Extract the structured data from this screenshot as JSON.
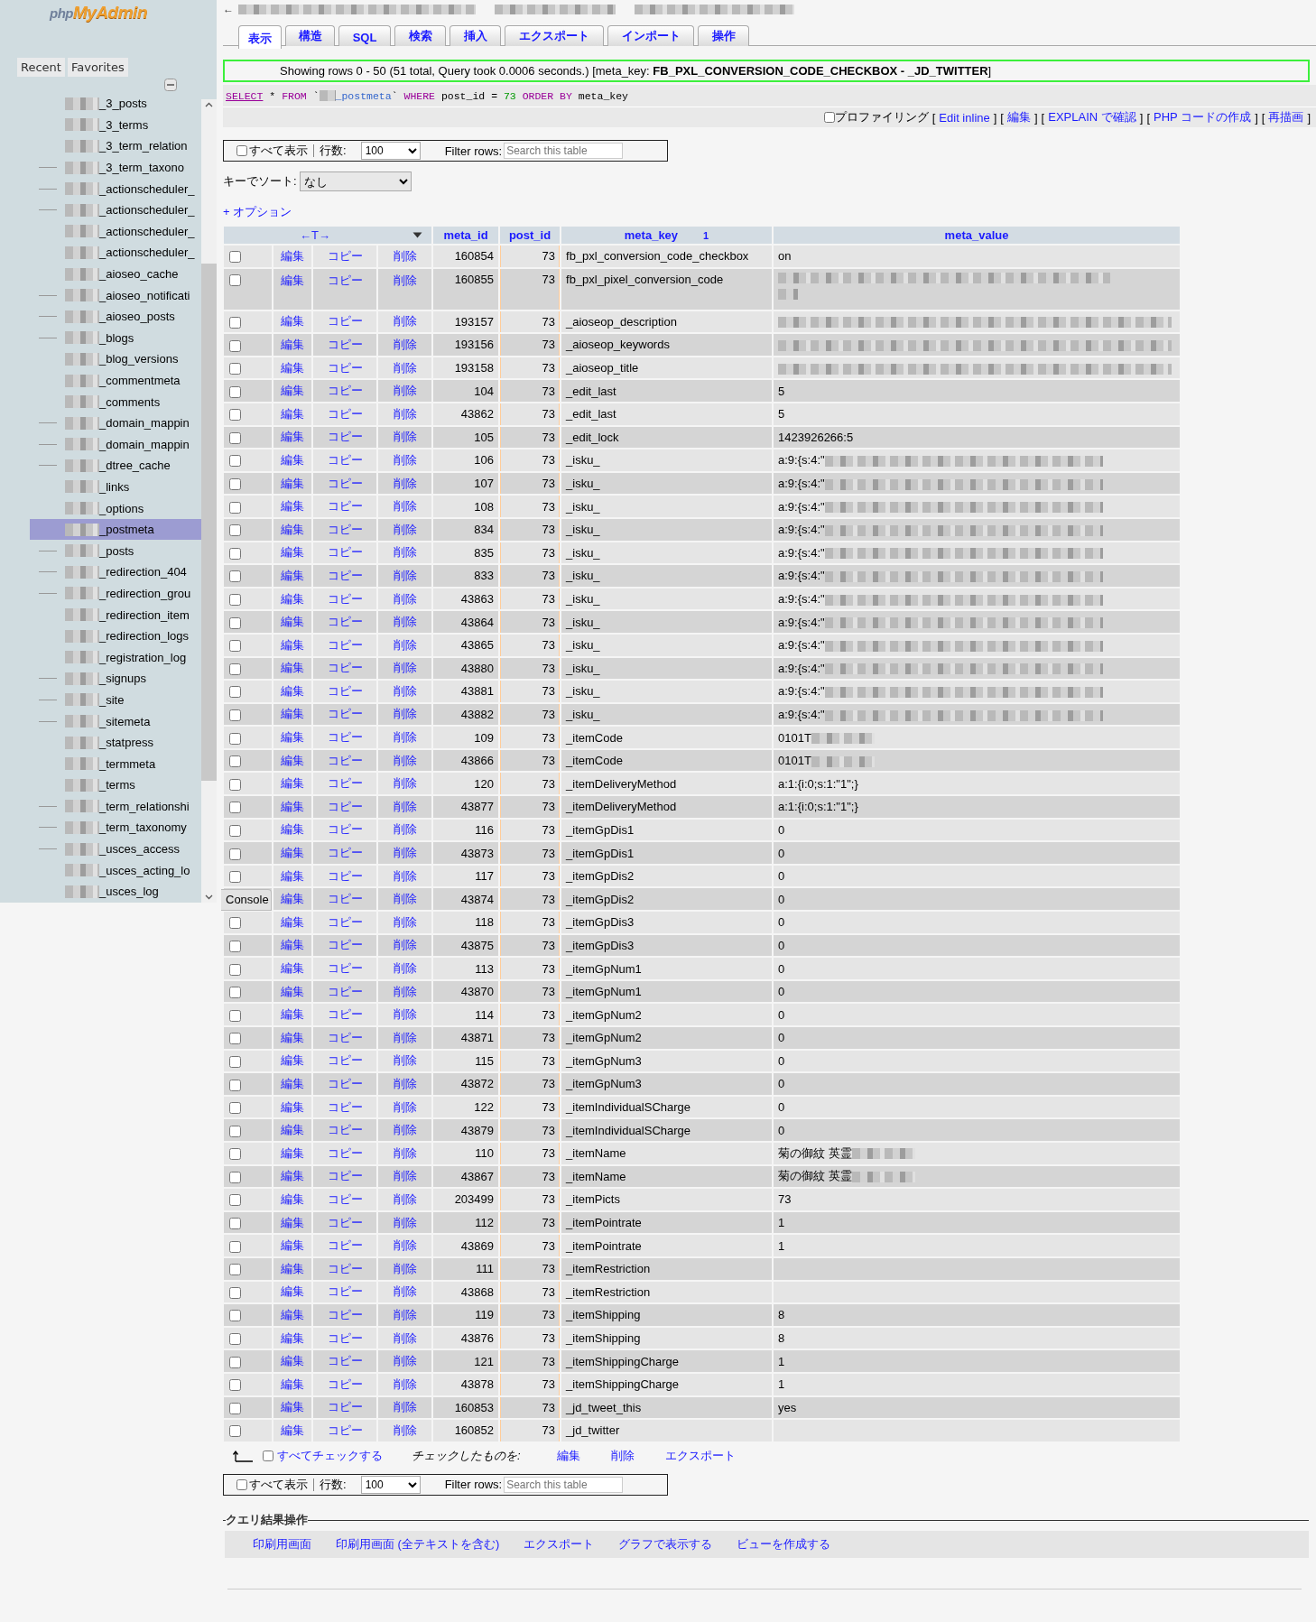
{
  "sidebar": {
    "logo": {
      "prefix": "php",
      "name": "MyAdmin"
    },
    "buttons": [
      "Recent",
      "Favorites"
    ],
    "tables": [
      {
        "name": "_3_posts",
        "connector": false,
        "selected": false
      },
      {
        "name": "_3_terms",
        "connector": false,
        "selected": false
      },
      {
        "name": "_3_term_relation",
        "connector": false,
        "selected": false
      },
      {
        "name": "_3_term_taxono",
        "connector": true,
        "selected": false
      },
      {
        "name": "_actionscheduler_",
        "connector": true,
        "selected": false
      },
      {
        "name": "_actionscheduler_",
        "connector": true,
        "selected": false
      },
      {
        "name": "_actionscheduler_",
        "connector": false,
        "selected": false
      },
      {
        "name": "_actionscheduler_",
        "connector": false,
        "selected": false
      },
      {
        "name": "_aioseo_cache",
        "connector": false,
        "selected": false
      },
      {
        "name": "_aioseo_notificati",
        "connector": true,
        "selected": false
      },
      {
        "name": "_aioseo_posts",
        "connector": true,
        "selected": false
      },
      {
        "name": "_blogs",
        "connector": true,
        "selected": false
      },
      {
        "name": "_blog_versions",
        "connector": false,
        "selected": false
      },
      {
        "name": "_commentmeta",
        "connector": false,
        "selected": false
      },
      {
        "name": "_comments",
        "connector": false,
        "selected": false
      },
      {
        "name": "_domain_mappin",
        "connector": true,
        "selected": false
      },
      {
        "name": "_domain_mappin",
        "connector": true,
        "selected": false
      },
      {
        "name": "_dtree_cache",
        "connector": true,
        "selected": false
      },
      {
        "name": "_links",
        "connector": false,
        "selected": false
      },
      {
        "name": "_options",
        "connector": false,
        "selected": false
      },
      {
        "name": "_postmeta",
        "connector": false,
        "selected": true
      },
      {
        "name": "_posts",
        "connector": true,
        "selected": false
      },
      {
        "name": "_redirection_404",
        "connector": true,
        "selected": false
      },
      {
        "name": "_redirection_grou",
        "connector": true,
        "selected": false
      },
      {
        "name": "_redirection_item",
        "connector": false,
        "selected": false
      },
      {
        "name": "_redirection_logs",
        "connector": false,
        "selected": false
      },
      {
        "name": "_registration_log",
        "connector": false,
        "selected": false
      },
      {
        "name": "_signups",
        "connector": true,
        "selected": false
      },
      {
        "name": "_site",
        "connector": true,
        "selected": false
      },
      {
        "name": "_sitemeta",
        "connector": true,
        "selected": false
      },
      {
        "name": "_statpress",
        "connector": false,
        "selected": false
      },
      {
        "name": "_termmeta",
        "connector": false,
        "selected": false
      },
      {
        "name": "_terms",
        "connector": false,
        "selected": false
      },
      {
        "name": "_term_relationshi",
        "connector": true,
        "selected": false
      },
      {
        "name": "_term_taxonomy",
        "connector": true,
        "selected": false
      },
      {
        "name": "_usces_access",
        "connector": true,
        "selected": false
      },
      {
        "name": "_usces_acting_lo",
        "connector": false,
        "selected": false
      },
      {
        "name": "_usces_log",
        "connector": false,
        "selected": false
      }
    ]
  },
  "console": "Console",
  "breadcrumb": {
    "back": "←"
  },
  "tabs": [
    {
      "label": "表示",
      "selected": true
    },
    {
      "label": "構造",
      "selected": false
    },
    {
      "label": "SQL",
      "selected": false
    },
    {
      "label": "検索",
      "selected": false
    },
    {
      "label": "挿入",
      "selected": false
    },
    {
      "label": "エクスポート",
      "selected": false
    },
    {
      "label": "インポート",
      "selected": false
    },
    {
      "label": "操作",
      "selected": false
    }
  ],
  "message": "Showing rows 0 - 50 (51 total, Query took 0.0006 seconds.) [meta_key: **FB_PXL_CONVERSION_CODE_CHECKBOX - _JD_TWITTER**]",
  "sql": [
    {
      "kind": "keyword",
      "text": "SELECT"
    },
    {
      "kind": "plain",
      "text": " * "
    },
    {
      "kind": "keyword",
      "text": "FROM"
    },
    {
      "kind": "plain",
      "text": " `"
    },
    {
      "kind": "redacted_name",
      "text": "_postmeta"
    },
    {
      "kind": "plain",
      "text": "` "
    },
    {
      "kind": "keyword",
      "text": "WHERE"
    },
    {
      "kind": "plain",
      "text": " post_id = "
    },
    {
      "kind": "number",
      "text": "73"
    },
    {
      "kind": "keyword",
      "text": " ORDER BY"
    },
    {
      "kind": "plain",
      "text": " meta_key"
    }
  ],
  "profiling": {
    "label": "プロファイリング",
    "checked": false,
    "links": [
      {
        "before": "[",
        "label": "Edit inline",
        "after": "]"
      },
      {
        "before": "[",
        "label": "編集",
        "after": "]"
      },
      {
        "before": "[",
        "label": "EXPLAIN で確認",
        "after": "]"
      },
      {
        "before": "[",
        "label": "PHP コードの作成",
        "after": "]"
      },
      {
        "before": "[",
        "label": "再描画",
        "after": "]"
      }
    ]
  },
  "nav_top": {
    "show_all": "すべて表示",
    "show_all_checked": false,
    "rows_label": "行数:",
    "rows_value": "100",
    "filter_label": "Filter rows:",
    "filter_placeholder": "Search this table"
  },
  "sort": {
    "label": "キーでソート:",
    "value": "なし"
  },
  "options": "+ オプション",
  "table": {
    "toggle": "←T→",
    "columns": [
      {
        "label": "meta_id"
      },
      {
        "label": "post_id"
      },
      {
        "label": "meta_key",
        "sort_index": "1"
      },
      {
        "label": "meta_value"
      }
    ],
    "rows": [
      {
        "kind": "plain",
        "checked": false,
        "edit": "編集",
        "copy": "コピー",
        "delete": "削除",
        "meta_id": "160854",
        "post_id": "73",
        "meta_key": "fb_pxl_conversion_code_checkbox",
        "meta_value": "on"
      },
      {
        "kind": "twoline",
        "checked": false,
        "edit": "編集",
        "copy": "コピー",
        "delete": "削除",
        "meta_id": "160855",
        "post_id": "73",
        "meta_key": "fb_pxl_pixel_conversion_code"
      },
      {
        "kind": "redacted",
        "checked": false,
        "edit": "編集",
        "copy": "コピー",
        "delete": "削除",
        "meta_id": "193157",
        "post_id": "73",
        "meta_key": "_aioseop_description"
      },
      {
        "kind": "redacted",
        "checked": false,
        "edit": "編集",
        "copy": "コピー",
        "delete": "削除",
        "meta_id": "193156",
        "post_id": "73",
        "meta_key": "_aioseop_keywords"
      },
      {
        "kind": "redacted",
        "checked": false,
        "edit": "編集",
        "copy": "コピー",
        "delete": "削除",
        "meta_id": "193158",
        "post_id": "73",
        "meta_key": "_aioseop_title"
      },
      {
        "kind": "plain",
        "checked": false,
        "edit": "編集",
        "copy": "コピー",
        "delete": "削除",
        "meta_id": "104",
        "post_id": "73",
        "meta_key": "_edit_last",
        "meta_value": "5"
      },
      {
        "kind": "plain",
        "checked": false,
        "edit": "編集",
        "copy": "コピー",
        "delete": "削除",
        "meta_id": "43862",
        "post_id": "73",
        "meta_key": "_edit_last",
        "meta_value": "5"
      },
      {
        "kind": "plain",
        "checked": false,
        "edit": "編集",
        "copy": "コピー",
        "delete": "削除",
        "meta_id": "105",
        "post_id": "73",
        "meta_key": "_edit_lock",
        "meta_value": "1423926266:5"
      },
      {
        "kind": "longtail",
        "checked": false,
        "edit": "編集",
        "copy": "コピー",
        "delete": "削除",
        "meta_id": "106",
        "post_id": "73",
        "meta_key": "_isku_",
        "meta_value": "a:9:{s:4:\""
      },
      {
        "kind": "longtail",
        "checked": false,
        "edit": "編集",
        "copy": "コピー",
        "delete": "削除",
        "meta_id": "107",
        "post_id": "73",
        "meta_key": "_isku_",
        "meta_value": "a:9:{s:4:\""
      },
      {
        "kind": "longtail",
        "checked": false,
        "edit": "編集",
        "copy": "コピー",
        "delete": "削除",
        "meta_id": "108",
        "post_id": "73",
        "meta_key": "_isku_",
        "meta_value": "a:9:{s:4:\""
      },
      {
        "kind": "longtail",
        "checked": false,
        "edit": "編集",
        "copy": "コピー",
        "delete": "削除",
        "meta_id": "834",
        "post_id": "73",
        "meta_key": "_isku_",
        "meta_value": "a:9:{s:4:\""
      },
      {
        "kind": "longtail",
        "checked": false,
        "edit": "編集",
        "copy": "コピー",
        "delete": "削除",
        "meta_id": "835",
        "post_id": "73",
        "meta_key": "_isku_",
        "meta_value": "a:9:{s:4:\""
      },
      {
        "kind": "longtail",
        "checked": false,
        "edit": "編集",
        "copy": "コピー",
        "delete": "削除",
        "meta_id": "833",
        "post_id": "73",
        "meta_key": "_isku_",
        "meta_value": "a:9:{s:4:\""
      },
      {
        "kind": "longtail",
        "checked": false,
        "edit": "編集",
        "copy": "コピー",
        "delete": "削除",
        "meta_id": "43863",
        "post_id": "73",
        "meta_key": "_isku_",
        "meta_value": "a:9:{s:4:\""
      },
      {
        "kind": "longtail",
        "checked": false,
        "edit": "編集",
        "copy": "コピー",
        "delete": "削除",
        "meta_id": "43864",
        "post_id": "73",
        "meta_key": "_isku_",
        "meta_value": "a:9:{s:4:\""
      },
      {
        "kind": "longtail",
        "checked": false,
        "edit": "編集",
        "copy": "コピー",
        "delete": "削除",
        "meta_id": "43865",
        "post_id": "73",
        "meta_key": "_isku_",
        "meta_value": "a:9:{s:4:\""
      },
      {
        "kind": "longtail",
        "checked": false,
        "edit": "編集",
        "copy": "コピー",
        "delete": "削除",
        "meta_id": "43880",
        "post_id": "73",
        "meta_key": "_isku_",
        "meta_value": "a:9:{s:4:\""
      },
      {
        "kind": "longtail",
        "checked": false,
        "edit": "編集",
        "copy": "コピー",
        "delete": "削除",
        "meta_id": "43881",
        "post_id": "73",
        "meta_key": "_isku_",
        "meta_value": "a:9:{s:4:\""
      },
      {
        "kind": "longtail",
        "checked": false,
        "edit": "編集",
        "copy": "コピー",
        "delete": "削除",
        "meta_id": "43882",
        "post_id": "73",
        "meta_key": "_isku_",
        "meta_value": "a:9:{s:4:\""
      },
      {
        "kind": "shorttail",
        "checked": false,
        "edit": "編集",
        "copy": "コピー",
        "delete": "削除",
        "meta_id": "109",
        "post_id": "73",
        "meta_key": "_itemCode",
        "meta_value": "0101T"
      },
      {
        "kind": "shorttail",
        "checked": false,
        "edit": "編集",
        "copy": "コピー",
        "delete": "削除",
        "meta_id": "43866",
        "post_id": "73",
        "meta_key": "_itemCode",
        "meta_value": "0101T"
      },
      {
        "kind": "plain",
        "checked": false,
        "edit": "編集",
        "copy": "コピー",
        "delete": "削除",
        "meta_id": "120",
        "post_id": "73",
        "meta_key": "_itemDeliveryMethod",
        "meta_value": "a:1:{i:0;s:1:\"1\";}"
      },
      {
        "kind": "plain",
        "checked": false,
        "edit": "編集",
        "copy": "コピー",
        "delete": "削除",
        "meta_id": "43877",
        "post_id": "73",
        "meta_key": "_itemDeliveryMethod",
        "meta_value": "a:1:{i:0;s:1:\"1\";}"
      },
      {
        "kind": "plain",
        "checked": false,
        "edit": "編集",
        "copy": "コピー",
        "delete": "削除",
        "meta_id": "116",
        "post_id": "73",
        "meta_key": "_itemGpDis1",
        "meta_value": "0"
      },
      {
        "kind": "plain",
        "checked": false,
        "edit": "編集",
        "copy": "コピー",
        "delete": "削除",
        "meta_id": "43873",
        "post_id": "73",
        "meta_key": "_itemGpDis1",
        "meta_value": "0"
      },
      {
        "kind": "plain",
        "checked": false,
        "edit": "編集",
        "copy": "コピー",
        "delete": "削除",
        "meta_id": "117",
        "post_id": "73",
        "meta_key": "_itemGpDis2",
        "meta_value": "0"
      },
      {
        "kind": "plain",
        "edit": "編集",
        "copy": "コピー",
        "delete": "削除",
        "meta_id": "43874",
        "post_id": "73",
        "meta_key": "_itemGpDis2",
        "meta_value": "0"
      },
      {
        "kind": "plain",
        "checked": false,
        "edit": "編集",
        "copy": "コピー",
        "delete": "削除",
        "meta_id": "118",
        "post_id": "73",
        "meta_key": "_itemGpDis3",
        "meta_value": "0"
      },
      {
        "kind": "plain",
        "checked": false,
        "edit": "編集",
        "copy": "コピー",
        "delete": "削除",
        "meta_id": "43875",
        "post_id": "73",
        "meta_key": "_itemGpDis3",
        "meta_value": "0"
      },
      {
        "kind": "plain",
        "checked": false,
        "edit": "編集",
        "copy": "コピー",
        "delete": "削除",
        "meta_id": "113",
        "post_id": "73",
        "meta_key": "_itemGpNum1",
        "meta_value": "0"
      },
      {
        "kind": "plain",
        "checked": false,
        "edit": "編集",
        "copy": "コピー",
        "delete": "削除",
        "meta_id": "43870",
        "post_id": "73",
        "meta_key": "_itemGpNum1",
        "meta_value": "0"
      },
      {
        "kind": "plain",
        "checked": false,
        "edit": "編集",
        "copy": "コピー",
        "delete": "削除",
        "meta_id": "114",
        "post_id": "73",
        "meta_key": "_itemGpNum2",
        "meta_value": "0"
      },
      {
        "kind": "plain",
        "checked": false,
        "edit": "編集",
        "copy": "コピー",
        "delete": "削除",
        "meta_id": "43871",
        "post_id": "73",
        "meta_key": "_itemGpNum2",
        "meta_value": "0"
      },
      {
        "kind": "plain",
        "checked": false,
        "edit": "編集",
        "copy": "コピー",
        "delete": "削除",
        "meta_id": "115",
        "post_id": "73",
        "meta_key": "_itemGpNum3",
        "meta_value": "0"
      },
      {
        "kind": "plain",
        "checked": false,
        "edit": "編集",
        "copy": "コピー",
        "delete": "削除",
        "meta_id": "43872",
        "post_id": "73",
        "meta_key": "_itemGpNum3",
        "meta_value": "0"
      },
      {
        "kind": "plain",
        "checked": false,
        "edit": "編集",
        "copy": "コピー",
        "delete": "削除",
        "meta_id": "122",
        "post_id": "73",
        "meta_key": "_itemIndividualSCharge",
        "meta_value": "0"
      },
      {
        "kind": "plain",
        "checked": false,
        "edit": "編集",
        "copy": "コピー",
        "delete": "削除",
        "meta_id": "43879",
        "post_id": "73",
        "meta_key": "_itemIndividualSCharge",
        "meta_value": "0"
      },
      {
        "kind": "shorttail",
        "checked": false,
        "edit": "編集",
        "copy": "コピー",
        "delete": "削除",
        "meta_id": "110",
        "post_id": "73",
        "meta_key": "_itemName",
        "meta_value": "菊の御紋 英霊"
      },
      {
        "kind": "shorttail",
        "checked": false,
        "edit": "編集",
        "copy": "コピー",
        "delete": "削除",
        "meta_id": "43867",
        "post_id": "73",
        "meta_key": "_itemName",
        "meta_value": "菊の御紋 英霊"
      },
      {
        "kind": "plain",
        "checked": false,
        "edit": "編集",
        "copy": "コピー",
        "delete": "削除",
        "meta_id": "203499",
        "post_id": "73",
        "meta_key": "_itemPicts",
        "meta_value": "73"
      },
      {
        "kind": "plain",
        "checked": false,
        "edit": "編集",
        "copy": "コピー",
        "delete": "削除",
        "meta_id": "112",
        "post_id": "73",
        "meta_key": "_itemPointrate",
        "meta_value": "1"
      },
      {
        "kind": "plain",
        "checked": false,
        "edit": "編集",
        "copy": "コピー",
        "delete": "削除",
        "meta_id": "43869",
        "post_id": "73",
        "meta_key": "_itemPointrate",
        "meta_value": "1"
      },
      {
        "kind": "plain",
        "checked": false,
        "edit": "編集",
        "copy": "コピー",
        "delete": "削除",
        "meta_id": "111",
        "post_id": "73",
        "meta_key": "_itemRestriction"
      },
      {
        "kind": "plain",
        "checked": false,
        "edit": "編集",
        "copy": "コピー",
        "delete": "削除",
        "meta_id": "43868",
        "post_id": "73",
        "meta_key": "_itemRestriction"
      },
      {
        "kind": "plain",
        "checked": false,
        "edit": "編集",
        "copy": "コピー",
        "delete": "削除",
        "meta_id": "119",
        "post_id": "73",
        "meta_key": "_itemShipping",
        "meta_value": "8"
      },
      {
        "kind": "plain",
        "checked": false,
        "edit": "編集",
        "copy": "コピー",
        "delete": "削除",
        "meta_id": "43876",
        "post_id": "73",
        "meta_key": "_itemShipping",
        "meta_value": "8"
      },
      {
        "kind": "plain",
        "checked": false,
        "edit": "編集",
        "copy": "コピー",
        "delete": "削除",
        "meta_id": "121",
        "post_id": "73",
        "meta_key": "_itemShippingCharge",
        "meta_value": "1"
      },
      {
        "kind": "plain",
        "checked": false,
        "edit": "編集",
        "copy": "コピー",
        "delete": "削除",
        "meta_id": "43878",
        "post_id": "73",
        "meta_key": "_itemShippingCharge",
        "meta_value": "1"
      },
      {
        "kind": "plain",
        "checked": false,
        "edit": "編集",
        "copy": "コピー",
        "delete": "削除",
        "meta_id": "160853",
        "post_id": "73",
        "meta_key": "_jd_tweet_this",
        "meta_value": "yes"
      },
      {
        "kind": "plain",
        "checked": false,
        "edit": "編集",
        "copy": "コピー",
        "delete": "削除",
        "meta_id": "160852",
        "post_id": "73",
        "meta_key": "_jd_twitter"
      }
    ]
  },
  "bulk": {
    "check_all": "すべてチェックする",
    "check_all_checked": false,
    "with_selected": "チェックしたものを:",
    "actions": [
      "編集",
      "削除",
      "エクスポート"
    ]
  },
  "nav_bottom": {
    "show_all": "すべて表示",
    "show_all_checked": false,
    "rows_label": "行数:",
    "rows_value": "100",
    "filter_label": "Filter rows:",
    "filter_placeholder": "Search this table"
  },
  "query_ops": {
    "legend": "クエリ結果操作",
    "links": [
      "印刷用画面",
      "印刷用画面 (全テキストを含む)",
      "エクスポート",
      "グラフで表示する",
      "ビューを作成する"
    ]
  }
}
